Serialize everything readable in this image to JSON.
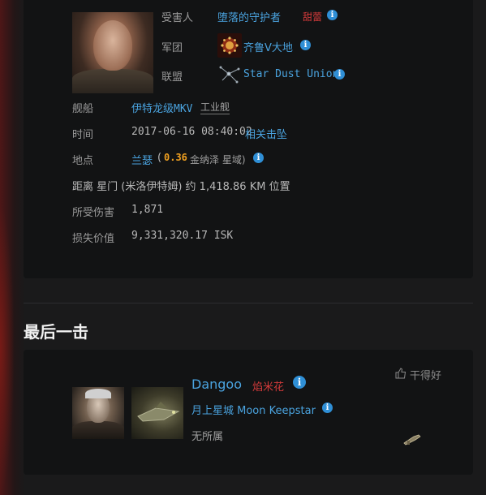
{
  "victim": {
    "label_victim": "受害人",
    "name": "堕落的守护者",
    "tag": "甜蕾",
    "label_corp": "军团",
    "corp": "齐鲁V大地",
    "label_alliance": "联盟",
    "alliance": "Star Dust Union"
  },
  "details": {
    "label_ship": "舰船",
    "ship": "伊特龙级MKV",
    "ship_class": "工业舰",
    "label_time": "时间",
    "time": "2017-06-16 08:40:02",
    "related_kills": "相关击坠",
    "label_location": "地点",
    "system": "兰瑟",
    "security_open": "(",
    "security": "0.36",
    "region": "金纳泽 星域)",
    "distance": "距离 星门 (米洛伊特姆) 约 1,418.86 KM 位置",
    "label_damage": "所受伤害",
    "damage": "1,871",
    "label_value": "损失价值",
    "value": "9,331,320.17 ISK"
  },
  "final_blow": {
    "title": "最后一击",
    "attacker_name": "Dangoo",
    "attacker_tag": "焰米花",
    "corp": "月上星城 Moon Keepstar",
    "alliance": "无所属",
    "like_label": "干得好"
  },
  "icons": {
    "info": "i",
    "info_name": "info-icon",
    "thumbs_up": "thumbs-up-icon",
    "weapon": "weapon-icon"
  },
  "colors": {
    "link": "#4aa3df",
    "tag_red": "#d23a3a",
    "security_orange": "#f0a020",
    "panel": "#121314",
    "background": "#1a1a1b"
  }
}
